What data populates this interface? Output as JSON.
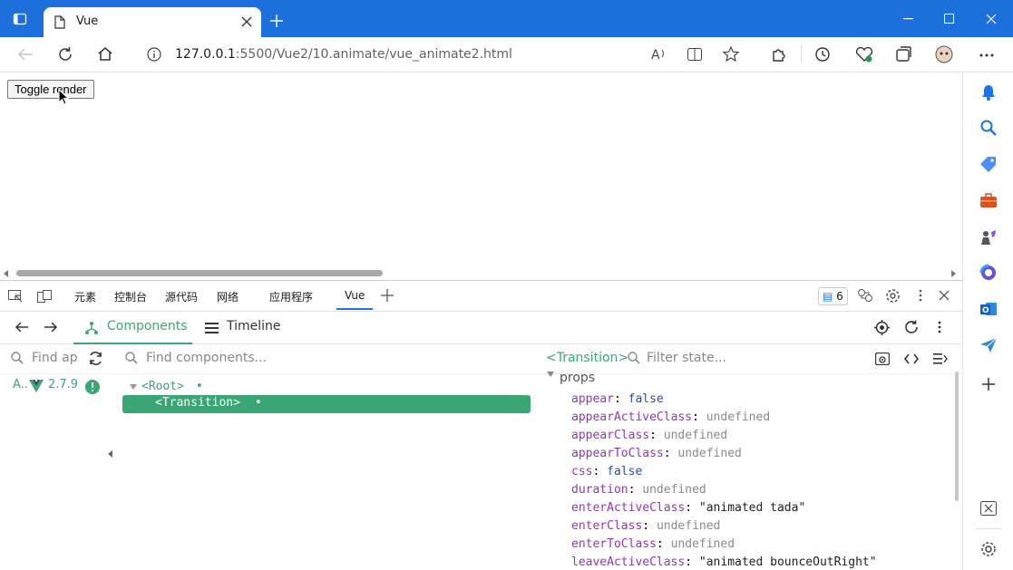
{
  "browser": {
    "tab_title": "Vue",
    "url_host": "127.0.0.1",
    "url_rest": ":5500/Vue2/10.animate/vue_animate2.html",
    "notifications_count": "6"
  },
  "page": {
    "toggle_label": "Toggle render"
  },
  "devtools": {
    "tabs": [
      "元素",
      "控制台",
      "源代码",
      "网络",
      "应用程序",
      "Vue"
    ],
    "messages_count": "6"
  },
  "vue": {
    "components_tab": "Components",
    "timeline_tab": "Timeline",
    "app_search_placeholder": "Find ap",
    "component_search_placeholder": "Find components...",
    "app_label": "A..",
    "vue_version": "2.7.9",
    "tree": {
      "root": "<Root>",
      "child": "<Transition>"
    },
    "selected_component": "<Transition>",
    "state_filter_placeholder": "Filter state...",
    "section": "props",
    "props": [
      {
        "key": "appear",
        "value": "false",
        "kind": "bool"
      },
      {
        "key": "appearActiveClass",
        "value": "undefined",
        "kind": "undef"
      },
      {
        "key": "appearClass",
        "value": "undefined",
        "kind": "undef"
      },
      {
        "key": "appearToClass",
        "value": "undefined",
        "kind": "undef"
      },
      {
        "key": "css",
        "value": "false",
        "kind": "bool"
      },
      {
        "key": "duration",
        "value": "undefined",
        "kind": "undef"
      },
      {
        "key": "enterActiveClass",
        "value": "\"animated tada\"",
        "kind": "str"
      },
      {
        "key": "enterClass",
        "value": "undefined",
        "kind": "undef"
      },
      {
        "key": "enterToClass",
        "value": "undefined",
        "kind": "undef"
      },
      {
        "key": "leaveActiveClass",
        "value": "\"animated bounceOutRight\"",
        "kind": "str"
      }
    ]
  }
}
